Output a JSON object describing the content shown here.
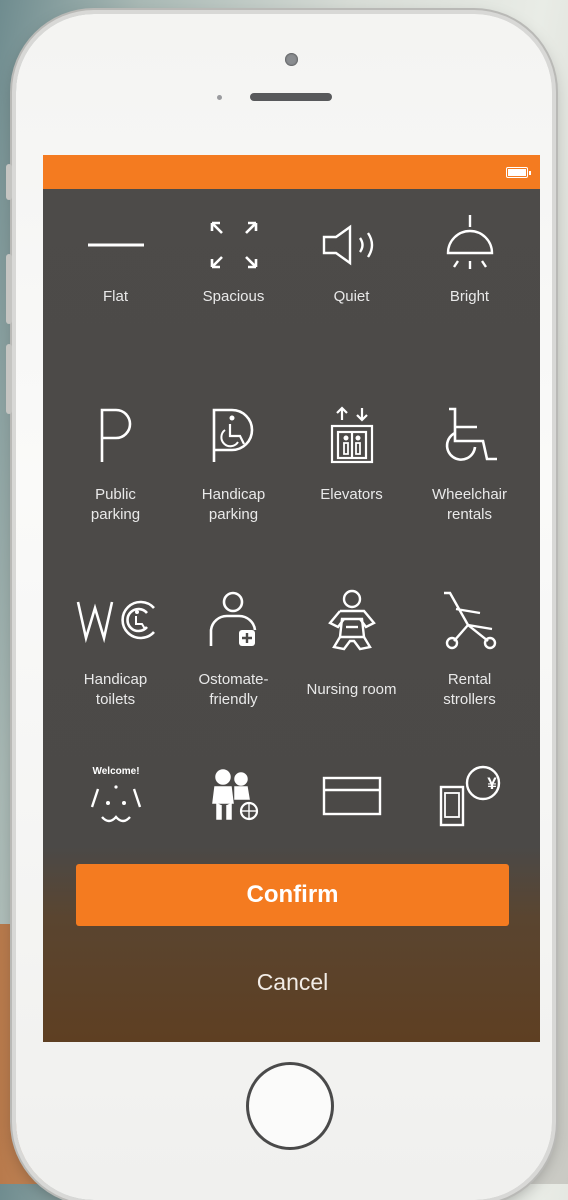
{
  "statusbar": {
    "color": "#f47b20",
    "battery_icon": "battery-full-icon"
  },
  "amenities": [
    {
      "label": "Flat",
      "icon": "flat-line-icon"
    },
    {
      "label": "Spacious",
      "icon": "expand-arrows-icon"
    },
    {
      "label": "Quiet",
      "icon": "speaker-icon"
    },
    {
      "label": "Bright",
      "icon": "ceiling-lamp-icon"
    },
    {
      "label": "Public\nparking",
      "icon": "parking-icon"
    },
    {
      "label": "Handicap\nparking",
      "icon": "handicap-parking-icon"
    },
    {
      "label": "Elevators",
      "icon": "elevator-icon"
    },
    {
      "label": "Wheelchair\nrentals",
      "icon": "wheelchair-icon"
    },
    {
      "label": "Handicap\ntoilets",
      "icon": "handicap-toilet-icon"
    },
    {
      "label": "Ostomate-\nfriendly",
      "icon": "ostomate-icon"
    },
    {
      "label": "Nursing room",
      "icon": "baby-icon"
    },
    {
      "label": "Rental\nstrollers",
      "icon": "stroller-icon"
    },
    {
      "label": "",
      "icon": "pet-welcome-icon"
    },
    {
      "label": "",
      "icon": "family-wheelchair-icon"
    },
    {
      "label": "",
      "icon": "credit-card-icon"
    },
    {
      "label": "",
      "icon": "mobile-payment-yen-icon"
    }
  ],
  "pet_icon_text": "Welcome!",
  "yen_symbol": "¥",
  "actions": {
    "confirm_label": "Confirm",
    "cancel_label": "Cancel"
  },
  "colors": {
    "accent": "#f47b20",
    "screen_bg": "#4b4947"
  }
}
